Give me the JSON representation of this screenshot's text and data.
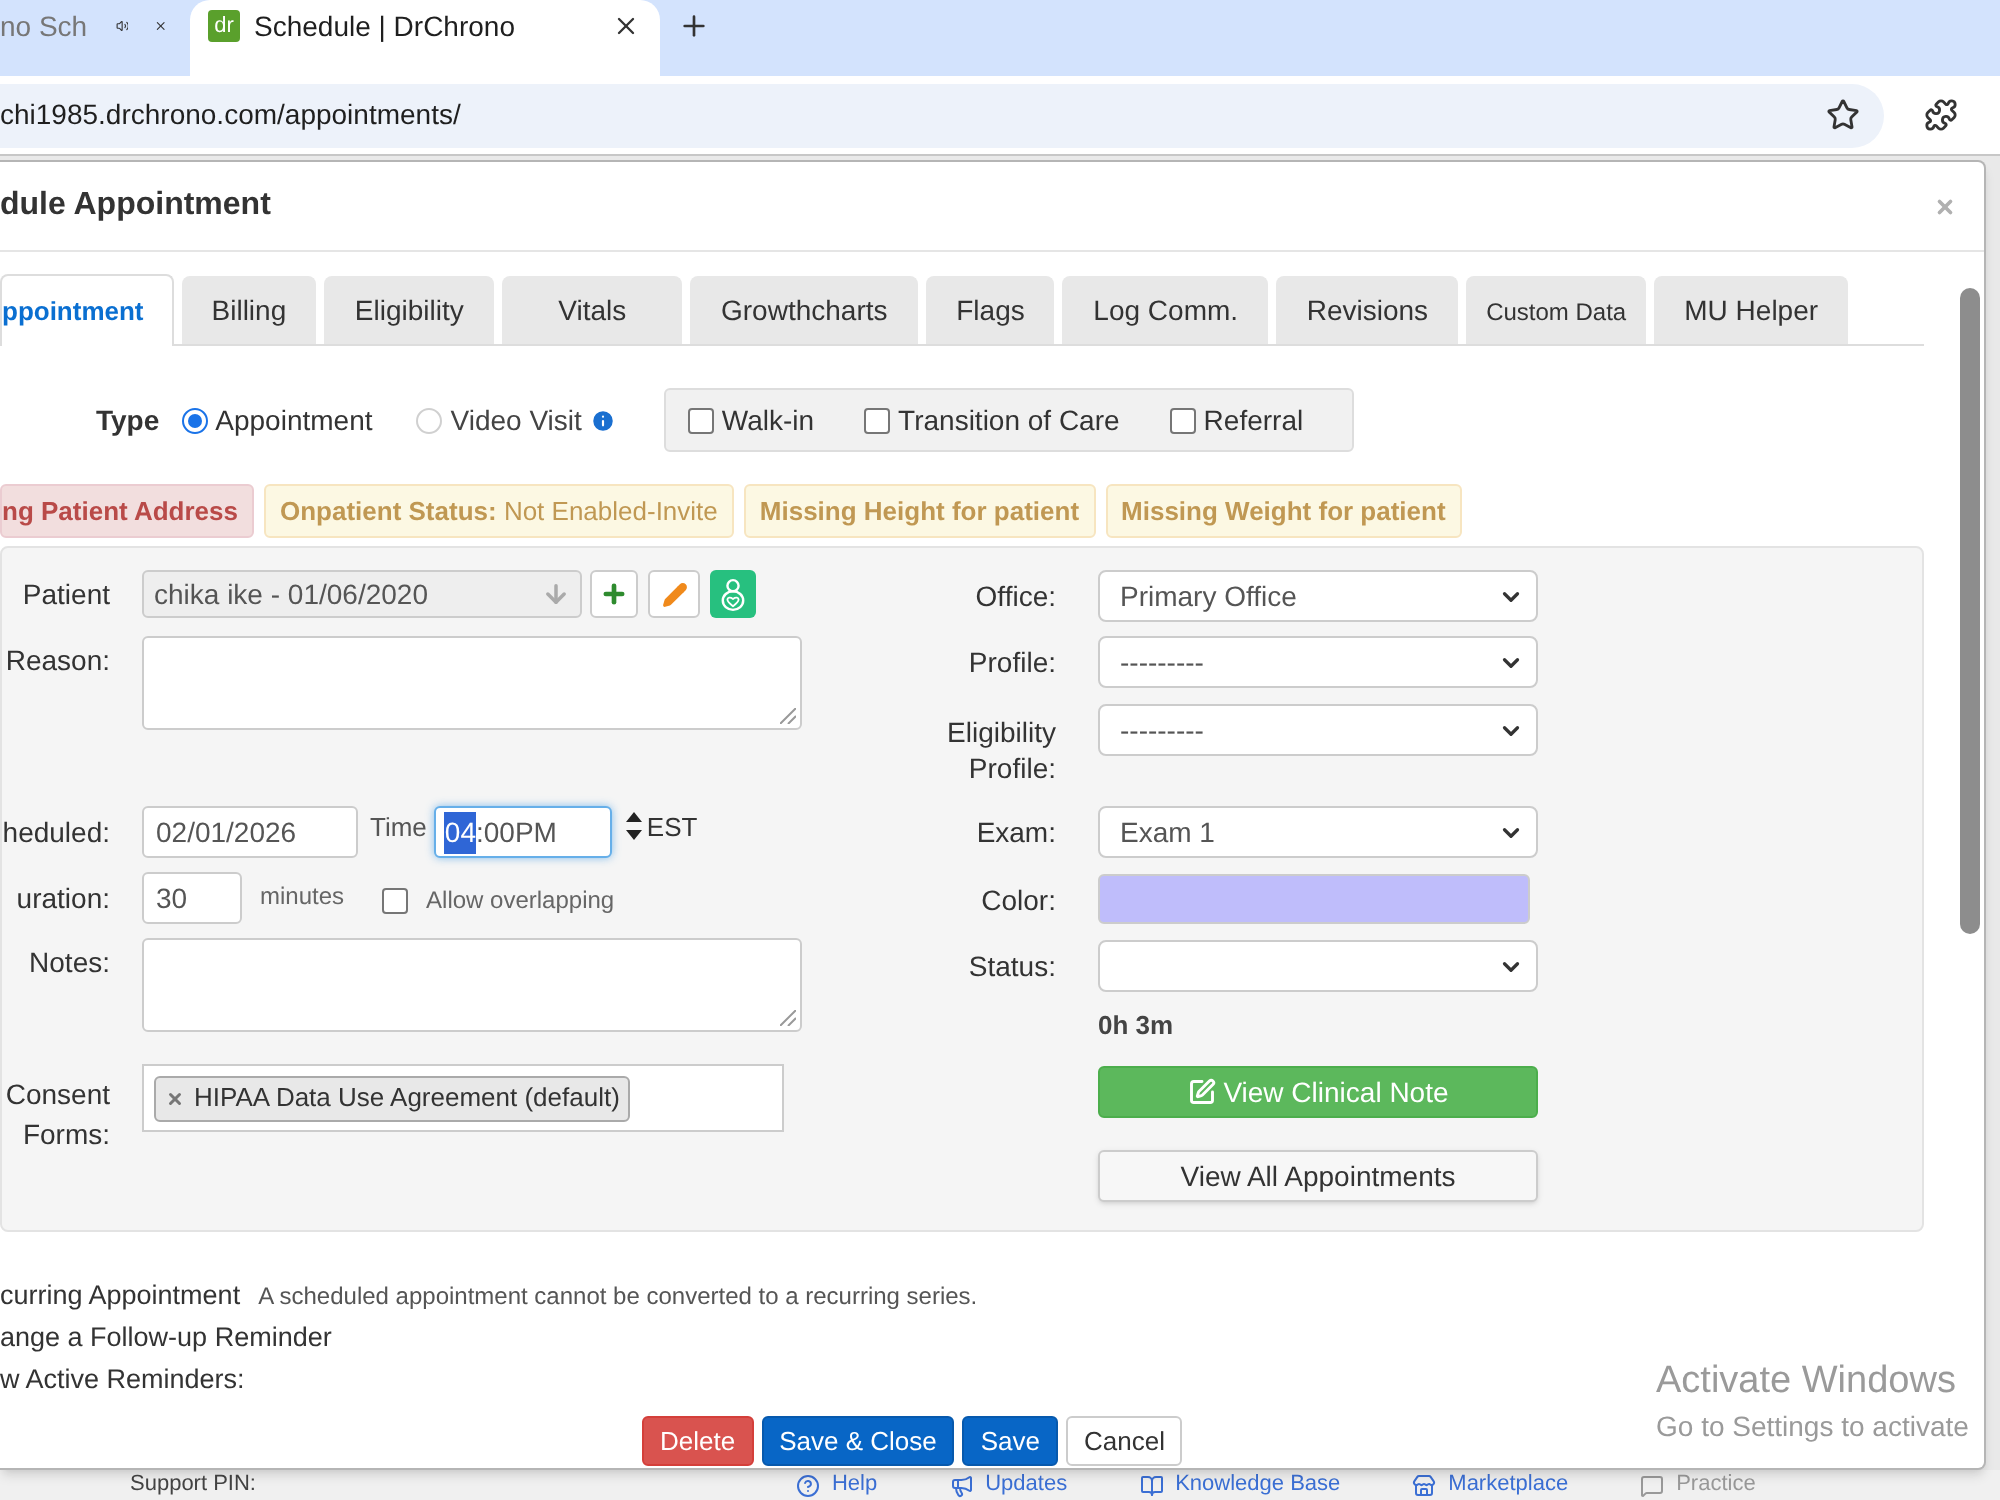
{
  "browser": {
    "tabs": [
      {
        "title": "no Sch",
        "selected": false,
        "audio": true
      },
      {
        "title": "Schedule | DrChrono",
        "selected": true,
        "favicon": "dr"
      }
    ],
    "address": "chi1985.drchrono.com/appointments/"
  },
  "dialog": {
    "title": "dule Appointment",
    "tabs": [
      {
        "label": "ppointment",
        "selected": true
      },
      {
        "label": "Billing",
        "selected": false
      },
      {
        "label": "Eligibility",
        "selected": false
      },
      {
        "label": "Vitals",
        "selected": false
      },
      {
        "label": "Growthcharts",
        "selected": false
      },
      {
        "label": "Flags",
        "selected": false
      },
      {
        "label": "Log Comm.",
        "selected": false
      },
      {
        "label": "Revisions",
        "selected": false
      },
      {
        "label": "Custom Data",
        "selected": false
      },
      {
        "label": "MU Helper",
        "selected": false
      }
    ],
    "type": {
      "label": "Type",
      "options": [
        {
          "label": "Appointment",
          "selected": true,
          "info": false
        },
        {
          "label": "Video Visit",
          "selected": false,
          "info": true
        }
      ],
      "flags": [
        {
          "label": "Walk-in",
          "checked": false
        },
        {
          "label": "Transition of Care",
          "checked": false
        },
        {
          "label": "Referral",
          "checked": false
        }
      ]
    },
    "alerts": [
      {
        "text": "ng Patient Address",
        "kind": "danger"
      },
      {
        "text": "**Onpatient Status:** Not Enabled-Invite",
        "kind": "status"
      },
      {
        "text": "Missing Height for patient",
        "kind": "warning"
      },
      {
        "text": "Missing Weight for patient",
        "kind": "warning"
      }
    ],
    "form": {
      "patient": {
        "label": "Patient",
        "value": "chika ike - 01/06/2020",
        "disabled": true
      },
      "reason": {
        "label": "Reason:"
      },
      "scheduled": {
        "label": "heduled:",
        "date": "02/01/2026",
        "time_label": "Time",
        "time_hour": "04",
        "time_rest": ":00PM",
        "focused": true,
        "timezone": "EST"
      },
      "duration": {
        "label": "uration:",
        "value": "30",
        "unit": "minutes",
        "overlap": {
          "label": "Allow overlapping",
          "checked": false
        }
      },
      "notes": {
        "label": "Notes:"
      },
      "consent": {
        "label": "Consent Forms:",
        "tags": [
          "HIPAA Data Use Agreement (default)"
        ]
      }
    },
    "right_fields": [
      {
        "kind": "select",
        "label": "Office:",
        "value": "Primary Office"
      },
      {
        "kind": "select",
        "label": "Profile:",
        "value": "---------"
      },
      {
        "kind": "select",
        "label": "Eligibility Profile:",
        "value": "---------"
      },
      {
        "kind": "select",
        "label": "Exam:",
        "value": "Exam 1"
      },
      {
        "kind": "color",
        "label": "Color:",
        "color": "#bfbdfb"
      },
      {
        "kind": "select",
        "label": "Status:"
      }
    ],
    "elapsed": "0h 3m",
    "clinical_note_button": "View Clinical Note",
    "all_appointments_button": "View All Appointments",
    "recurring": {
      "label": "curring Appointment",
      "note": "A scheduled appointment cannot be converted to a recurring series."
    },
    "follow_up": "ange a Follow-up Reminder",
    "active_reminders": "w Active Reminders:",
    "footer_buttons": [
      {
        "label": "Delete",
        "kind": "danger"
      },
      {
        "label": "Save & Close",
        "kind": "primary"
      },
      {
        "label": "Save",
        "kind": "primary"
      },
      {
        "label": "Cancel",
        "kind": "default"
      }
    ]
  },
  "status_bar": {
    "support": "Support PIN:",
    "links": [
      {
        "label": "Help",
        "kind": "help"
      },
      {
        "label": "Updates",
        "kind": "updates"
      },
      {
        "label": "Knowledge Base",
        "kind": "knowledge"
      },
      {
        "label": "Marketplace",
        "kind": "marketplace"
      },
      {
        "label": "Practice",
        "kind": "practice"
      }
    ]
  },
  "os_notice": {
    "title": "Activate Windows",
    "text": "Go to Settings to activate"
  }
}
